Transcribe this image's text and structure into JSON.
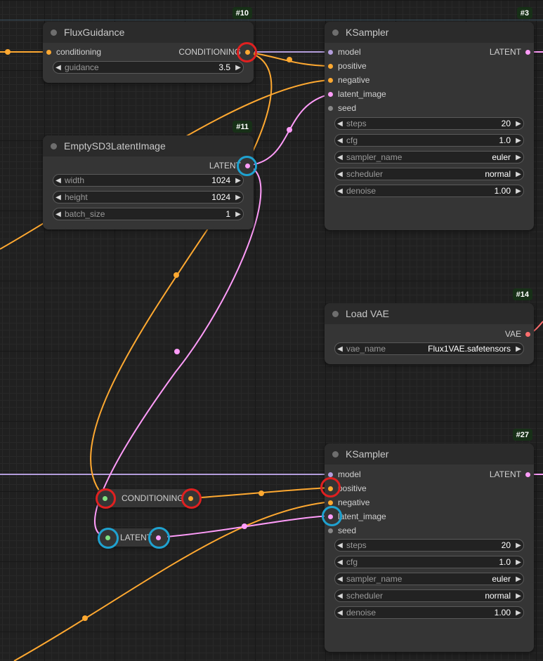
{
  "colors": {
    "conditioning": "#ffa931",
    "latent": "#ff9cf9",
    "model": "#b39ddb",
    "vae": "#ff6e6e",
    "clip": "#ffd500",
    "green_slot": "#7fe07f",
    "highlight_red": "#e02020",
    "highlight_blue": "#1fa2d0"
  },
  "nodes": {
    "flux_guidance": {
      "id": "#10",
      "title": "FluxGuidance",
      "input_conditioning": "conditioning",
      "output_conditioning": "CONDITIONING",
      "widgets": [
        {
          "label": "guidance",
          "value": "3.5"
        }
      ]
    },
    "empty_latent": {
      "id": "#11",
      "title": "EmptySD3LatentImage",
      "output_latent": "LATENT",
      "widgets": [
        {
          "label": "width",
          "value": "1024"
        },
        {
          "label": "height",
          "value": "1024"
        },
        {
          "label": "batch_size",
          "value": "1"
        }
      ]
    },
    "ksampler_3": {
      "id": "#3",
      "title": "KSampler",
      "inputs": [
        "model",
        "positive",
        "negative",
        "latent_image",
        "seed"
      ],
      "output_latent": "LATENT",
      "widgets": [
        {
          "label": "steps",
          "value": "20"
        },
        {
          "label": "cfg",
          "value": "1.0"
        },
        {
          "label": "sampler_name",
          "value": "euler"
        },
        {
          "label": "scheduler",
          "value": "normal"
        },
        {
          "label": "denoise",
          "value": "1.00"
        }
      ]
    },
    "load_vae": {
      "id": "#14",
      "title": "Load VAE",
      "output_vae": "VAE",
      "widgets": [
        {
          "label": "vae_name",
          "value": "Flux1VAE.safetensors"
        }
      ]
    },
    "ksampler_27": {
      "id": "#27",
      "title": "KSampler",
      "inputs": [
        "model",
        "positive",
        "negative",
        "latent_image",
        "seed"
      ],
      "output_latent": "LATENT",
      "widgets": [
        {
          "label": "steps",
          "value": "20"
        },
        {
          "label": "cfg",
          "value": "1.0"
        },
        {
          "label": "sampler_name",
          "value": "euler"
        },
        {
          "label": "scheduler",
          "value": "normal"
        },
        {
          "label": "denoise",
          "value": "1.00"
        }
      ]
    }
  },
  "reroutes": {
    "conditioning": {
      "label": "CONDITIONING"
    },
    "latent": {
      "label": "LATENT"
    }
  },
  "icons": {
    "widget_left": "◀",
    "widget_right": "▶"
  }
}
